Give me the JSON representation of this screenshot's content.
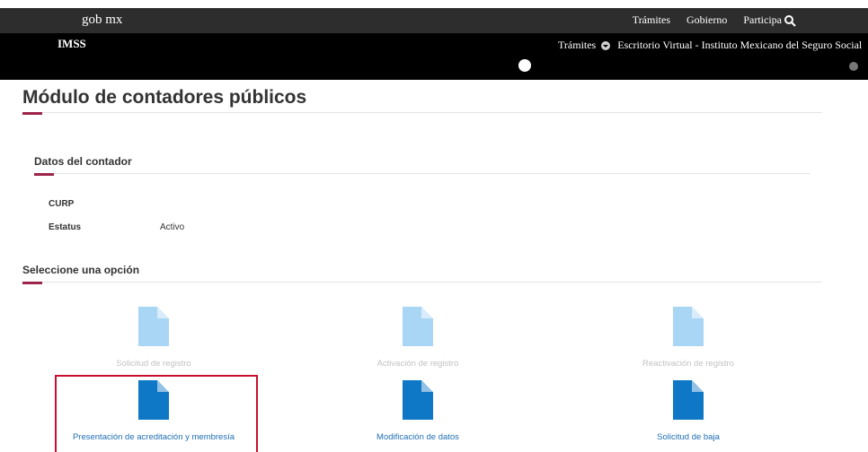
{
  "header": {
    "brand": "gob mx",
    "nav": [
      "Trámites",
      "Gobierno",
      "Participa"
    ],
    "search_icon": "search-icon"
  },
  "subheader": {
    "title": "IMSS",
    "tramites": "Trámites",
    "portal": "Escritorio Virtual - Instituto Mexicano del Seguro Social"
  },
  "page": {
    "title": "Módulo de contadores públicos",
    "accent_color": "#9d2449"
  },
  "contador": {
    "heading": "Datos del contador",
    "curp_label": "CURP",
    "curp_value": "",
    "estatus_label": "Estatus",
    "estatus_value": "Activo"
  },
  "options": {
    "heading": "Seleccione una opción",
    "items": [
      {
        "label": "Solicitud de registro",
        "enabled": false
      },
      {
        "label": "Activación de registro",
        "enabled": false
      },
      {
        "label": "Reactivación de registro",
        "enabled": false
      },
      {
        "label": "Presentación de acreditación y membresía",
        "enabled": true,
        "selected": true
      },
      {
        "label": "Modificación de datos",
        "enabled": true
      },
      {
        "label": "Solicitud de baja",
        "enabled": true
      }
    ]
  }
}
